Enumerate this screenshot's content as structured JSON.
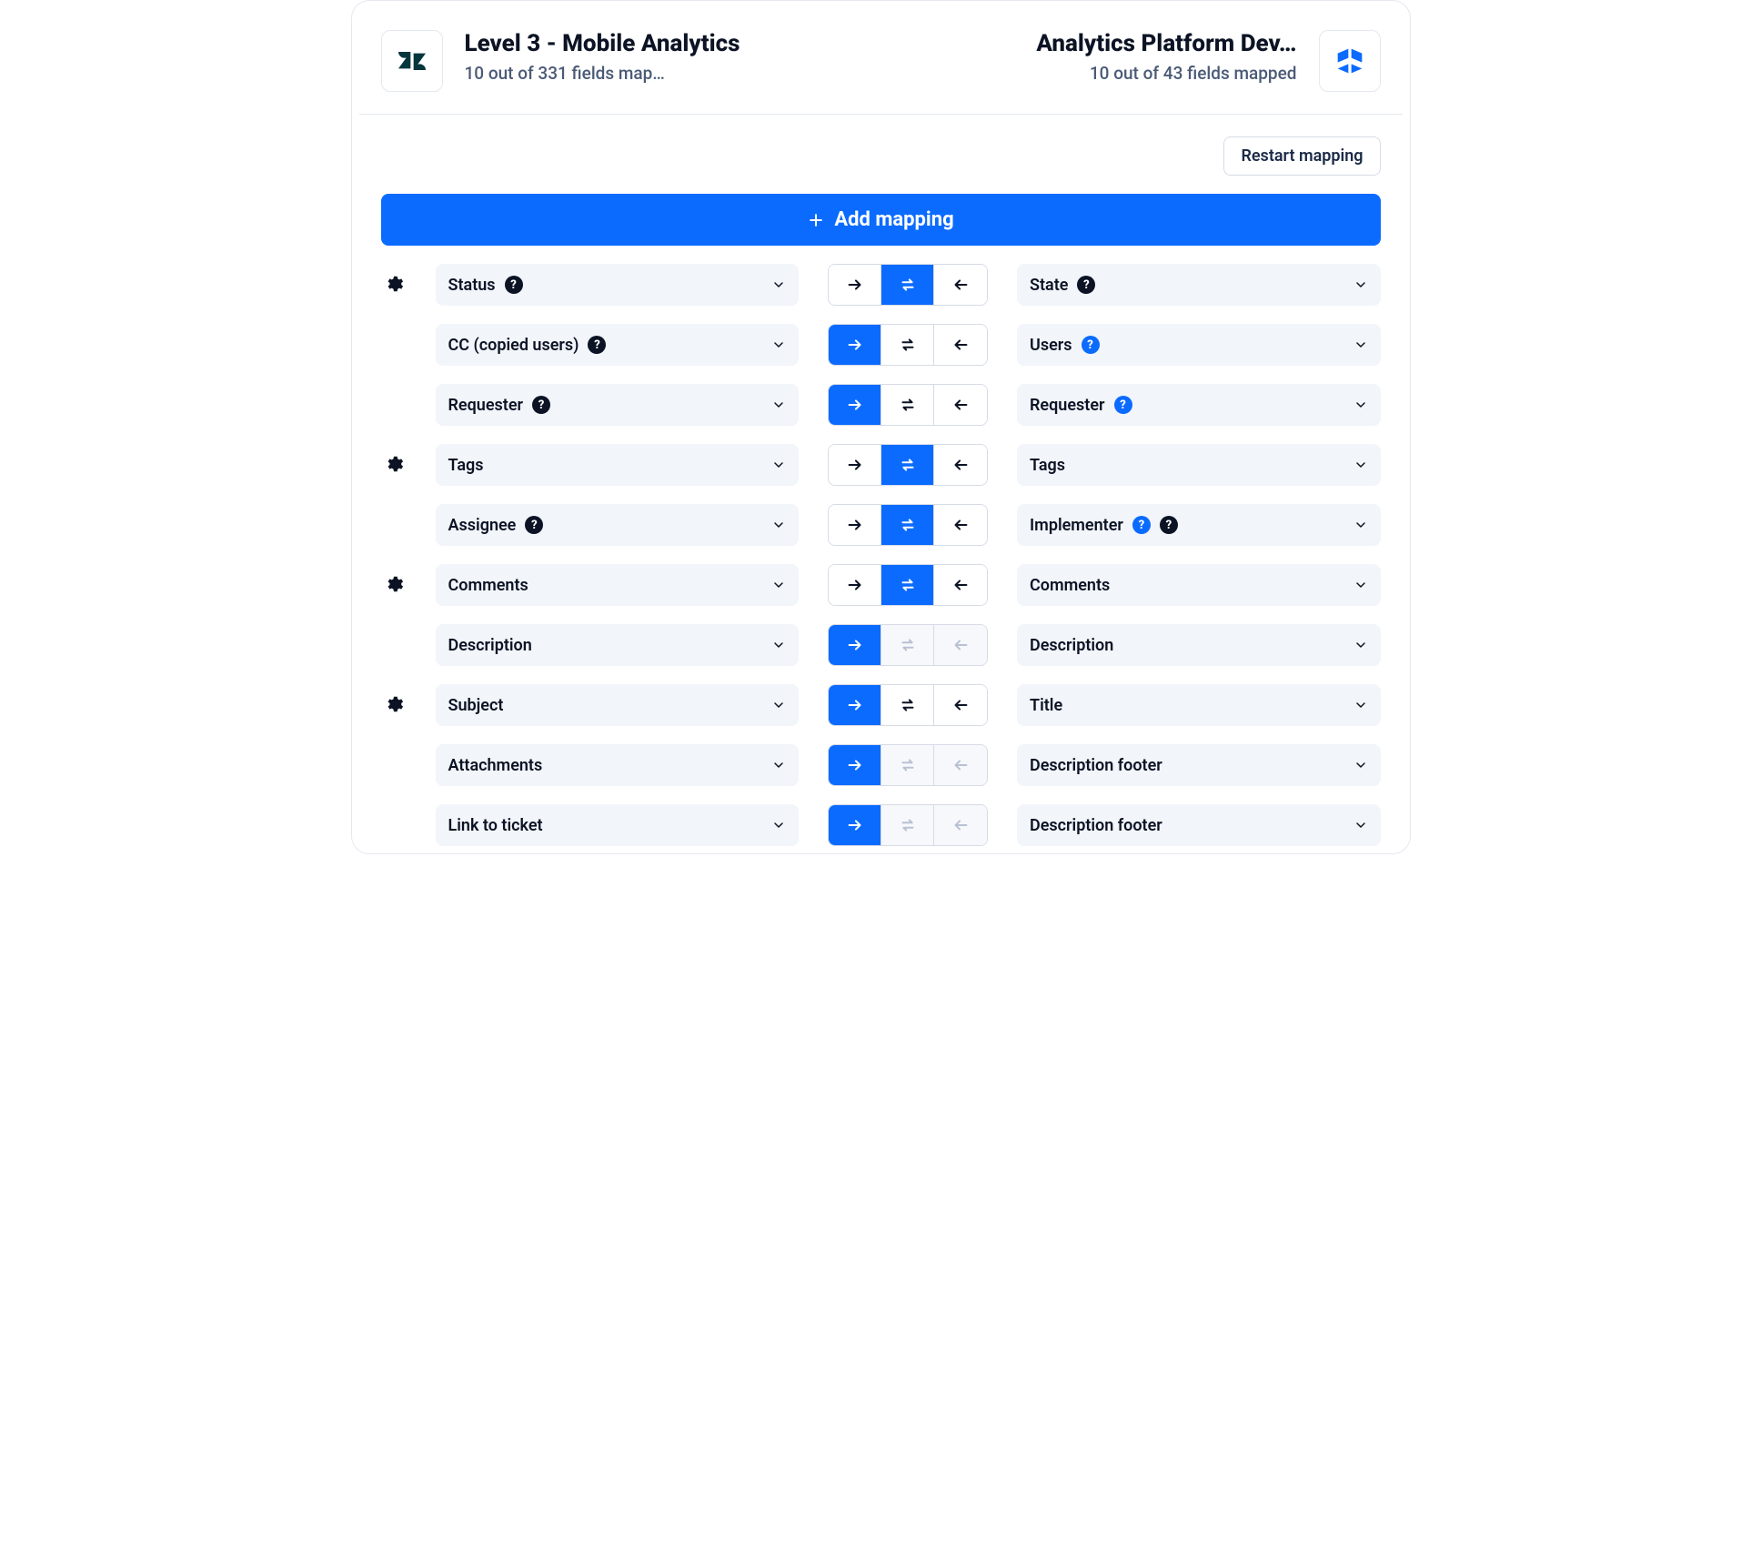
{
  "header": {
    "left": {
      "title": "Level 3 - Mobile Analytics",
      "subtitle": "10 out of 331 fields map…"
    },
    "right": {
      "title": "Analytics Platform Dev…",
      "subtitle": "10 out of 43 fields mapped"
    }
  },
  "toolbar": {
    "restart_label": "Restart mapping"
  },
  "add_button": {
    "label": "Add mapping"
  },
  "rows": [
    {
      "gear": true,
      "left": {
        "label": "Status",
        "badges": [
          "black"
        ]
      },
      "direction": {
        "active": "both",
        "disabled": []
      },
      "right": {
        "label": "State",
        "badges": [
          "black"
        ]
      }
    },
    {
      "gear": false,
      "left": {
        "label": "CC (copied users)",
        "badges": [
          "black"
        ]
      },
      "direction": {
        "active": "right",
        "disabled": []
      },
      "right": {
        "label": "Users",
        "badges": [
          "blue"
        ]
      }
    },
    {
      "gear": false,
      "left": {
        "label": "Requester",
        "badges": [
          "black"
        ]
      },
      "direction": {
        "active": "right",
        "disabled": []
      },
      "right": {
        "label": "Requester",
        "badges": [
          "blue"
        ]
      }
    },
    {
      "gear": true,
      "left": {
        "label": "Tags",
        "badges": []
      },
      "direction": {
        "active": "both",
        "disabled": []
      },
      "right": {
        "label": "Tags",
        "badges": []
      }
    },
    {
      "gear": false,
      "left": {
        "label": "Assignee",
        "badges": [
          "black"
        ]
      },
      "direction": {
        "active": "both",
        "disabled": []
      },
      "right": {
        "label": "Implementer",
        "badges": [
          "blue",
          "black"
        ]
      }
    },
    {
      "gear": true,
      "left": {
        "label": "Comments",
        "badges": []
      },
      "direction": {
        "active": "both",
        "disabled": []
      },
      "right": {
        "label": "Comments",
        "badges": []
      }
    },
    {
      "gear": false,
      "left": {
        "label": "Description",
        "badges": []
      },
      "direction": {
        "active": "right",
        "disabled": [
          "both",
          "left"
        ]
      },
      "right": {
        "label": "Description",
        "badges": []
      }
    },
    {
      "gear": true,
      "left": {
        "label": "Subject",
        "badges": []
      },
      "direction": {
        "active": "right",
        "disabled": []
      },
      "right": {
        "label": "Title",
        "badges": []
      }
    },
    {
      "gear": false,
      "left": {
        "label": "Attachments",
        "badges": []
      },
      "direction": {
        "active": "right",
        "disabled": [
          "both",
          "left"
        ]
      },
      "right": {
        "label": "Description footer",
        "badges": []
      }
    },
    {
      "gear": false,
      "left": {
        "label": "Link to ticket",
        "badges": []
      },
      "direction": {
        "active": "right",
        "disabled": [
          "both",
          "left"
        ]
      },
      "right": {
        "label": "Description footer",
        "badges": []
      }
    }
  ]
}
